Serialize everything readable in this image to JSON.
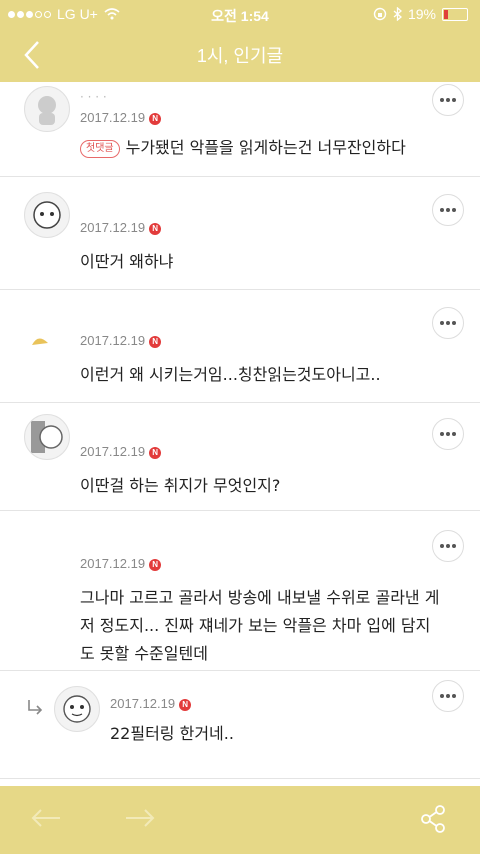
{
  "status_bar": {
    "carrier": "LG U+",
    "time": "오전 1:54",
    "battery": "19%"
  },
  "header": {
    "title": "1시, 인기글"
  },
  "comments": [
    {
      "date": "2017.12.19",
      "badge": "N",
      "first_badge": "첫댓글",
      "text": "누가됐던 악플을 읽게하는건 너무잔인하다"
    },
    {
      "date": "2017.12.19",
      "badge": "N",
      "text": "이딴거 왜하냐"
    },
    {
      "date": "2017.12.19",
      "badge": "N",
      "text": "이런거 왜 시키는거임...칭찬읽는것도아니고.."
    },
    {
      "date": "2017.12.19",
      "badge": "N",
      "text": "이딴걸 하는 취지가 무엇인지?"
    },
    {
      "date": "2017.12.19",
      "badge": "N",
      "text_lines": [
        "그나마 고르고 골라서 방송에 내보낼 수위로 골라낸 게",
        "저 정도지... 진짜 쟤네가 보는 악플은 차마 입에 담지",
        "도 못할 수준일텐데"
      ]
    },
    {
      "date": "2017.12.19",
      "badge": "N",
      "text": "22필터링 한거네.."
    }
  ],
  "colors": {
    "accent": "#e6d887",
    "badge_red": "#e23b3b"
  },
  "icons": {
    "back": "chevron-left-icon",
    "more": "more-dots-icon",
    "prev": "arrow-left-icon",
    "next": "arrow-right-icon",
    "share": "share-icon",
    "reply": "reply-arrow-icon"
  }
}
